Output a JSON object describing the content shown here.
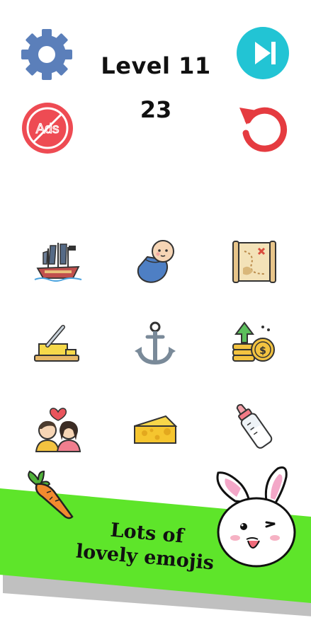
{
  "header": {
    "level_label": "Level 11",
    "counter": "23"
  },
  "buttons": {
    "no_ads_label": "Ads"
  },
  "grid": {
    "items": [
      {
        "icon": "pirate-ship-icon"
      },
      {
        "icon": "swaddled-baby-icon"
      },
      {
        "icon": "treasure-map-icon"
      },
      {
        "icon": "butter-knife-icon"
      },
      {
        "icon": "anchor-icon"
      },
      {
        "icon": "growing-coins-icon"
      },
      {
        "icon": "couple-in-love-icon"
      },
      {
        "icon": "cheese-icon"
      },
      {
        "icon": "baby-bottle-icon"
      }
    ]
  },
  "promo": {
    "line1": "Lots of",
    "line2": "lovely emojis",
    "banner_color": "#5ee52a"
  },
  "colors": {
    "settings": "#5b7fba",
    "skip": "#22c4d4",
    "no_ads": "#ee4b53",
    "restart": "#e53b40"
  }
}
